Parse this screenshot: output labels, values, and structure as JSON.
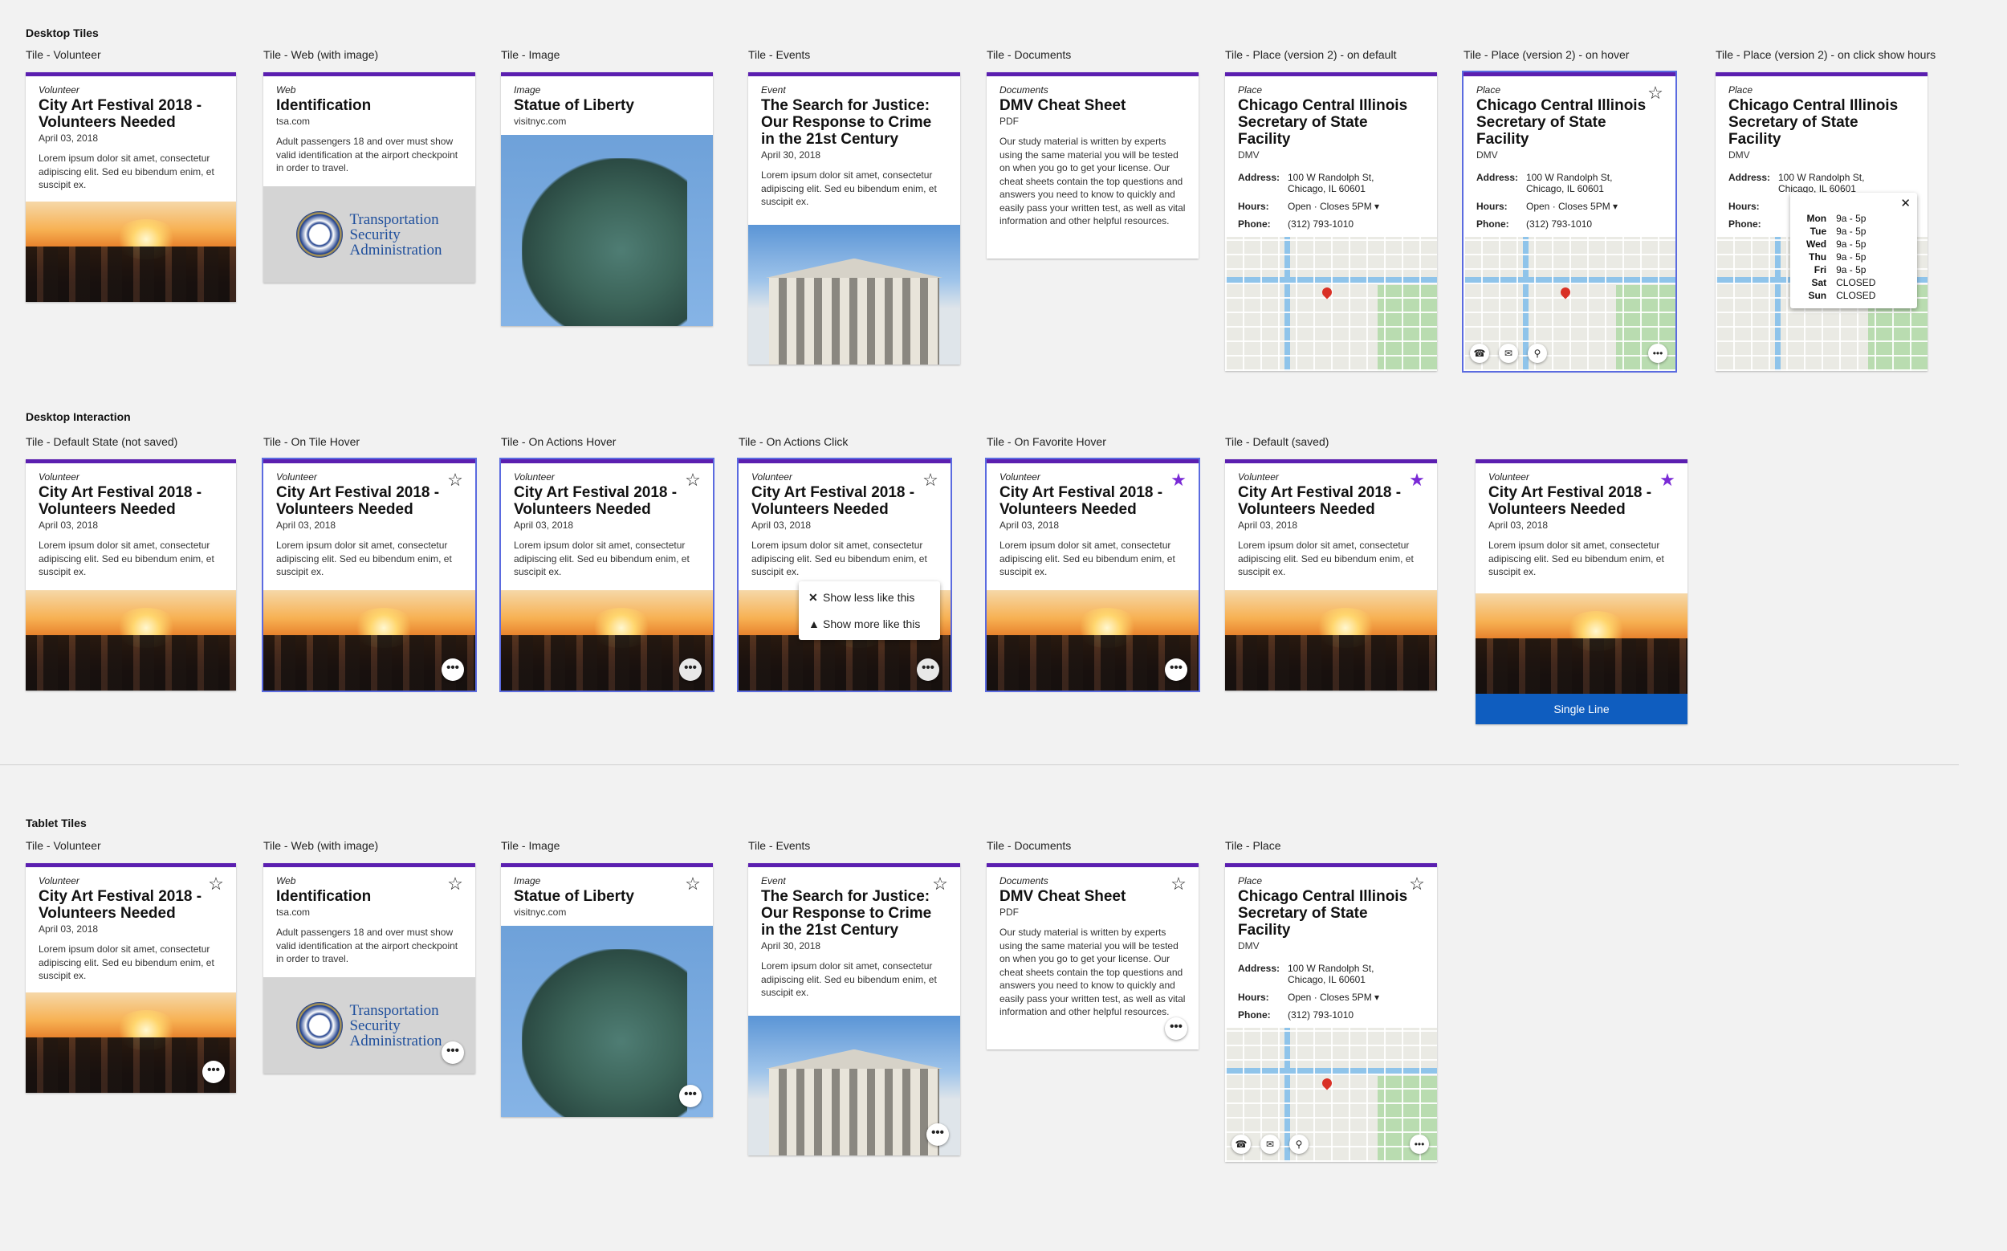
{
  "sections": {
    "desktop_tiles": "Desktop Tiles",
    "desktop_interaction": "Desktop Interaction",
    "tablet_tiles": "Tablet Tiles"
  },
  "labels": {
    "row1": [
      "Tile - Volunteer",
      "Tile - Web (with image)",
      "Tile - Image",
      "Tile - Events",
      "Tile - Documents",
      "Tile - Place (version 2) - on default",
      "Tile - Place (version 2) - on hover",
      "Tile - Place (version 2) - on click show hours"
    ],
    "row2": [
      "Tile - Default State (not saved)",
      "Tile - On Tile Hover",
      "Tile - On Actions Hover",
      "Tile - On Actions Click",
      "Tile - On Favorite Hover",
      "Tile - Default (saved)"
    ],
    "row3": [
      "Tile - Volunteer",
      "Tile - Web (with image)",
      "Tile - Image",
      "Tile - Events",
      "Tile - Documents",
      "Tile - Place"
    ]
  },
  "volunteer": {
    "category": "Volunteer",
    "title": "City Art Festival 2018 - Volunteers Needed",
    "date": "April 03, 2018",
    "body": "Lorem ipsum dolor sit amet, consectetur adipiscing elit. Sed eu bibendum enim, et suscipit ex."
  },
  "web": {
    "category": "Web",
    "title": "Identification",
    "source": "tsa.com",
    "body": "Adult passengers 18 and over must show valid identification at the airport checkpoint in order to travel.",
    "logo_line1": "Transportation",
    "logo_line2": "Security",
    "logo_line3": "Administration"
  },
  "image": {
    "category": "Image",
    "title": "Statue of Liberty",
    "source": "visitnyc.com"
  },
  "event": {
    "category": "Event",
    "title": "The Search for Justice: Our Response to Crime in the 21st Century",
    "date": "April 30, 2018",
    "body": "Lorem ipsum dolor sit amet, consectetur adipiscing elit. Sed eu bibendum enim, et suscipit ex."
  },
  "documents": {
    "category": "Documents",
    "title": "DMV Cheat Sheet",
    "type": "PDF",
    "body": "Our study material is written by experts using the same material you will be tested on when you go to get your license. Our cheat sheets contain the top questions and answers you need to know to quickly and easily pass your written test, as well as vital information and other helpful resources."
  },
  "place": {
    "category": "Place",
    "title": "Chicago Central Illinois Secretary of State Facility",
    "sub": "DMV",
    "address_label": "Address:",
    "address_line1": "100 W Randolph St,",
    "address_line2": "Chicago, IL 60601",
    "hours_label": "Hours:",
    "hours_value": "Open · Closes 5PM ▾",
    "phone_label": "Phone:",
    "phone_value": "(312) 793-1010"
  },
  "hours_popup": [
    {
      "day": "Mon",
      "time": "9a - 5p"
    },
    {
      "day": "Tue",
      "time": "9a - 5p"
    },
    {
      "day": "Wed",
      "time": "9a - 5p"
    },
    {
      "day": "Thu",
      "time": "9a - 5p"
    },
    {
      "day": "Fri",
      "time": "9a - 5p"
    },
    {
      "day": "Sat",
      "time": "CLOSED"
    },
    {
      "day": "Sun",
      "time": "CLOSED"
    }
  ],
  "menu": {
    "less": "Show less like this",
    "more": "Show more like this"
  },
  "cta": {
    "label": "Single Line"
  },
  "icons": {
    "more": "•••",
    "star_empty": "☆",
    "star_filled": "★",
    "close": "✕",
    "thumb": "👍",
    "phone": "☎",
    "mail": "✉",
    "pin": "⚲"
  }
}
